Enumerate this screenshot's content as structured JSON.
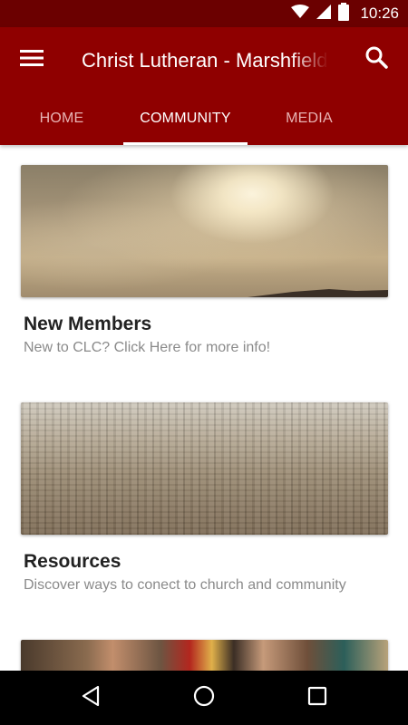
{
  "status_bar": {
    "time": "10:26"
  },
  "app_bar": {
    "title": "Christ Lutheran - Marshfield",
    "icons": {
      "menu": "hamburger-menu-icon",
      "search": "search-icon"
    }
  },
  "tabs": [
    {
      "label": "HOME",
      "active": false
    },
    {
      "label": "COMMUNITY",
      "active": true
    },
    {
      "label": "MEDIA",
      "active": false
    }
  ],
  "cards": [
    {
      "title": "New Members",
      "subtitle": "New to CLC?  Click Here for more info!",
      "image": "sky-clouds-image"
    },
    {
      "title": "Resources",
      "subtitle": "Discover ways to conect to church and community",
      "image": "city-skyline-image"
    },
    {
      "title": "",
      "subtitle": "",
      "image": "people-photo-image"
    }
  ],
  "colors": {
    "status_bar": "#6b0000",
    "app_bar": "#8f0000",
    "active_tab": "#ffffff",
    "inactive_tab": "#e8b3b3"
  }
}
